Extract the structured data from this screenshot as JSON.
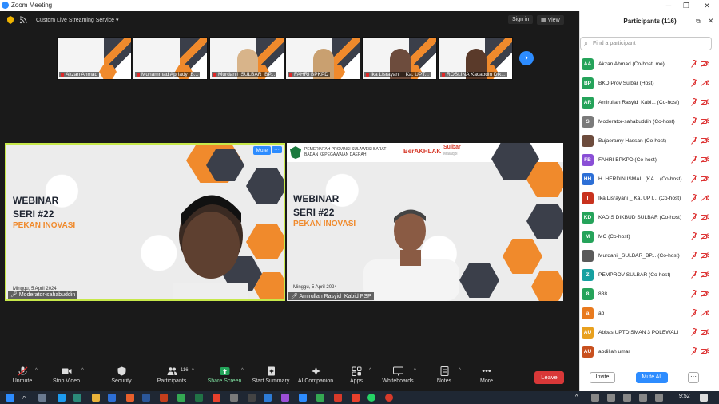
{
  "window": {
    "title": "Zoom Meeting"
  },
  "meeting_bar": {
    "service": "Custom Live Streaming Service",
    "sign_in": "Sign in",
    "view": "View"
  },
  "thumbnails": [
    {
      "name": "Akzan Ahmad",
      "has_person": false
    },
    {
      "name": "Muhammad Apriady_B...",
      "has_person": false
    },
    {
      "name": "Murdanil_SULBAR_BP...",
      "has_person": true
    },
    {
      "name": "FAHRI BPKPD",
      "has_person": true
    },
    {
      "name": "Ika Lisrayani _ Ka. UPT...",
      "has_person": true
    },
    {
      "name": "ROSLINA Kacabdin Dik...",
      "has_person": true
    }
  ],
  "slide": {
    "line1": "WEBINAR",
    "line2": "SERI #22",
    "line3": "PEKAN INOVASI",
    "date": "Minggu, 5 April 2024"
  },
  "tileA": {
    "name": "Moderator-sahabuddin",
    "mute_chip": "Mute",
    "more_chip": "···"
  },
  "tileB": {
    "name": "Amirullah Rasyid_Kabid PSP",
    "banner_l1": "PEMERINTAH PROVINSI SULAWESI BARAT",
    "banner_l2": "BADAN KEPEGAWAIAN DAERAH",
    "banner_brand": "BerAKHLAK",
    "banner_brand2": "Sulbar",
    "banner_brand3": "Malaqbi"
  },
  "toolbar": {
    "unmute": "Unmute",
    "stop_video": "Stop Video",
    "security": "Security",
    "participants": "Participants",
    "participants_count": "116",
    "share_screen": "Share Screen",
    "start_summary": "Start Summary",
    "ai_companion": "AI Companion",
    "apps": "Apps",
    "whiteboards": "Whiteboards",
    "notes": "Notes",
    "more": "More",
    "leave": "Leave"
  },
  "panel": {
    "title": "Participants (116)",
    "search_placeholder": "Find a participant",
    "invite": "Invite",
    "mute_all": "Mute All",
    "more": "···",
    "participants": [
      {
        "initials": "AA",
        "color": "#25a35a",
        "name": "Akzan Ahmad (Co-host, me)",
        "photo": false
      },
      {
        "initials": "BP",
        "color": "#25a35a",
        "name": "BKD Prov Sulbar (Host)",
        "photo": false
      },
      {
        "initials": "AR",
        "color": "#25a35a",
        "name": "Amirullah Rasyid_Kabi... (Co-host)",
        "photo": false
      },
      {
        "initials": "S",
        "color": "#7a7a7a",
        "name": "Moderator-sahabuddin (Co-host)",
        "photo": false
      },
      {
        "initials": "",
        "color": "#6d4c3d",
        "name": "Bujaeramy Hassan (Co-host)",
        "photo": true
      },
      {
        "initials": "FB",
        "color": "#8a4fd6",
        "name": "FAHRI BPKPD (Co-host)",
        "photo": false
      },
      {
        "initials": "HH",
        "color": "#2d6fd6",
        "name": "H. HERDIN ISMAIL (KA... (Co-host)",
        "photo": false
      },
      {
        "initials": "I",
        "color": "#c8321e",
        "name": "Ika Lisrayani _ Ka. UPT... (Co-host)",
        "photo": false
      },
      {
        "initials": "KD",
        "color": "#25a35a",
        "name": "KADIS DIKBUD SULBAR (Co-host)",
        "photo": false
      },
      {
        "initials": "M",
        "color": "#25a35a",
        "name": "MC (Co-host)",
        "photo": false
      },
      {
        "initials": "",
        "color": "#5a5a5a",
        "name": "Murdanil_SULBAR_BP... (Co-host)",
        "photo": true
      },
      {
        "initials": "Z",
        "color": "#16a0a0",
        "name": "PEMPROV SULBAR (Co-host)",
        "photo": false
      },
      {
        "initials": "8",
        "color": "#25a35a",
        "name": "888",
        "photo": false
      },
      {
        "initials": "a",
        "color": "#e87a1e",
        "name": "ab",
        "photo": false
      },
      {
        "initials": "AU",
        "color": "#e8a01e",
        "name": "Abbas UPTD SMAN 3 POLEWALI",
        "photo": false
      },
      {
        "initials": "AU",
        "color": "#c8501e",
        "name": "abdillah umar",
        "photo": false
      }
    ]
  },
  "taskbar": {
    "time": "9:52"
  }
}
